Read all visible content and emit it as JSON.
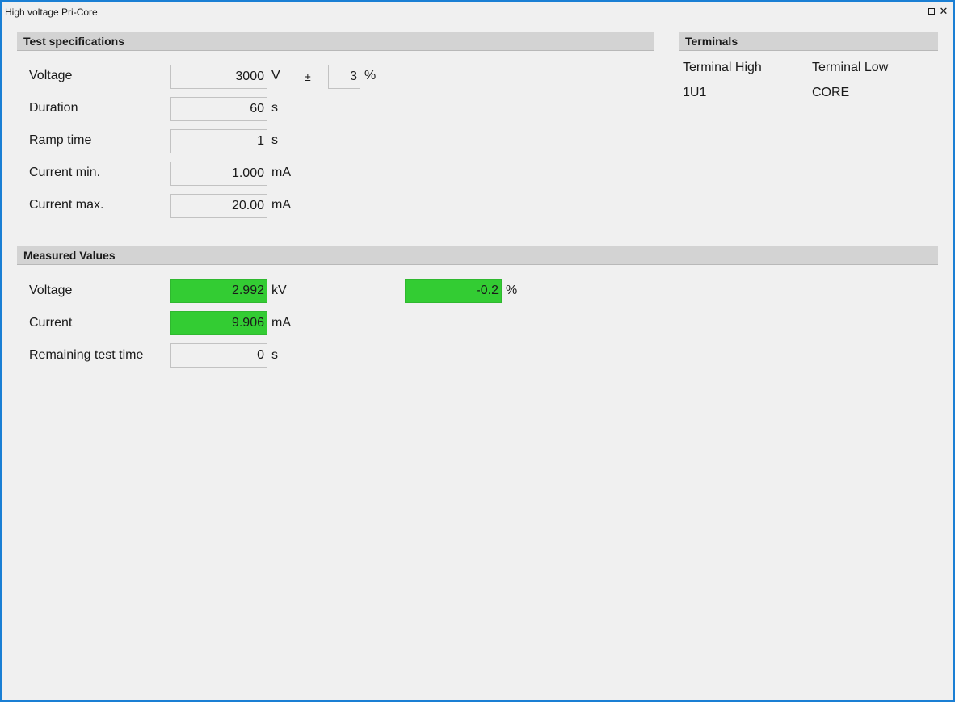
{
  "window": {
    "title": "High voltage Pri-Core"
  },
  "spec": {
    "header": "Test specifications",
    "voltage": {
      "label": "Voltage",
      "value": "3000",
      "unit": "V",
      "tol_sign": "±",
      "tol_value": "3",
      "tol_unit": "%"
    },
    "duration": {
      "label": "Duration",
      "value": "60",
      "unit": "s"
    },
    "ramp": {
      "label": "Ramp time",
      "value": "1",
      "unit": "s"
    },
    "current_min": {
      "label": "Current min.",
      "value": "1.000",
      "unit": "mA"
    },
    "current_max": {
      "label": "Current max.",
      "value": "20.00",
      "unit": "mA"
    }
  },
  "terminals": {
    "header": "Terminals",
    "high_label": "Terminal High",
    "low_label": "Terminal Low",
    "high_value": "1U1",
    "low_value": "CORE"
  },
  "measured": {
    "header": "Measured Values",
    "voltage": {
      "label": "Voltage",
      "value": "2.992",
      "unit": "kV",
      "dev_value": "-0.2",
      "dev_unit": "%"
    },
    "current": {
      "label": "Current",
      "value": "9.906",
      "unit": "mA"
    },
    "remaining": {
      "label": "Remaining test time",
      "value": "0",
      "unit": "s"
    }
  },
  "colors": {
    "ok": "#33cc33",
    "border": "#1a7fd4",
    "header_bg": "#d3d3d3"
  },
  "icons": {
    "restore": "restore-icon",
    "close": "close-icon"
  }
}
